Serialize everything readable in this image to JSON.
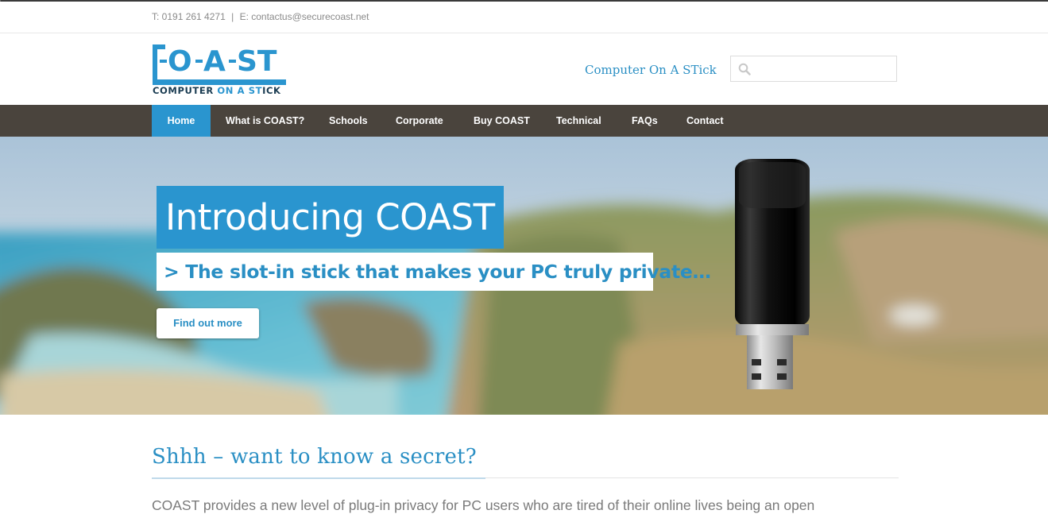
{
  "topbar": {
    "phone": "T: 0191 261 4271",
    "separator": "|",
    "email": "E: contactus@securecoast.net"
  },
  "header": {
    "logo_letters": [
      "C",
      "O",
      "A",
      "ST"
    ],
    "logo_subtitle_parts": [
      "COMPUTER ",
      "ON",
      " ",
      "A",
      " ",
      "ST",
      "ICK"
    ],
    "tagline": "Computer On A STick",
    "search": {
      "placeholder": "",
      "value": "",
      "icon": "search-icon"
    }
  },
  "nav": {
    "items": [
      {
        "label": "Home",
        "active": true
      },
      {
        "label": "What is COAST?"
      },
      {
        "label": "Schools"
      },
      {
        "label": "Corporate"
      },
      {
        "label": "Buy COAST"
      },
      {
        "label": "Technical"
      },
      {
        "label": "FAQs"
      },
      {
        "label": "Contact"
      }
    ]
  },
  "hero": {
    "title": "Introducing COAST",
    "subtitle": "> The slot-in stick that makes your PC truly private…",
    "button": "Find out more",
    "image": "usb-stick"
  },
  "main": {
    "heading": "Shhh – want to know a secret?",
    "intro": "COAST provides a new level of plug-in privacy for PC users who are tired of their online lives being an open"
  },
  "colors": {
    "accent": "#2a95cf",
    "text_blue": "#2a8fc4",
    "nav_bg": "#4a443d",
    "logo_dark": "#1a3c52"
  }
}
